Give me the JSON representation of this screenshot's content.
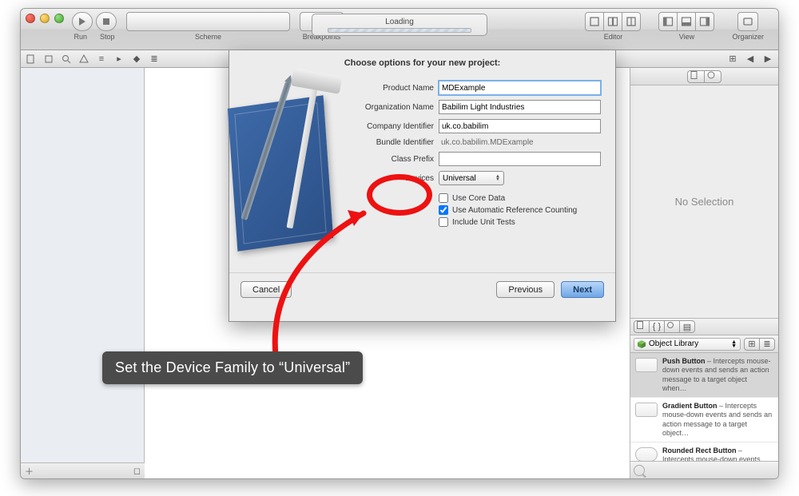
{
  "toolbar": {
    "run_label": "Run",
    "stop_label": "Stop",
    "scheme_label": "Scheme",
    "breakpoints_label": "Breakpoints",
    "editor_label": "Editor",
    "view_label": "View",
    "organizer_label": "Organizer",
    "status_text": "Loading"
  },
  "right_inspector": {
    "placeholder": "No Selection",
    "library_label": "Object Library",
    "items": [
      {
        "title": "Push Button",
        "desc": "Intercepts mouse-down events and sends an action message to a target object when…"
      },
      {
        "title": "Gradient Button",
        "desc": "Intercepts mouse-down events and sends an action message to a target object…"
      },
      {
        "title": "Rounded Rect Button",
        "desc": "Intercepts mouse-down events and sends an action message to a target object…"
      }
    ]
  },
  "sheet": {
    "title": "Choose options for your new project:",
    "fields": {
      "product_name_label": "Product Name",
      "product_name_value": "MDExample",
      "org_name_label": "Organization Name",
      "org_name_value": "Babilim Light Industries",
      "company_id_label": "Company Identifier",
      "company_id_value": "uk.co.babilim",
      "bundle_id_label": "Bundle Identifier",
      "bundle_id_value": "uk.co.babilim.MDExample",
      "class_prefix_label": "Class Prefix",
      "class_prefix_value": "",
      "devices_label": "Devices",
      "devices_value": "Universal"
    },
    "checks": {
      "use_core_data": "Use Core Data",
      "use_arc": "Use Automatic Reference Counting",
      "include_tests": "Include Unit Tests"
    },
    "buttons": {
      "cancel": "Cancel",
      "previous": "Previous",
      "next": "Next"
    }
  },
  "annotation": {
    "callout": "Set the Device Family to “Universal”"
  }
}
